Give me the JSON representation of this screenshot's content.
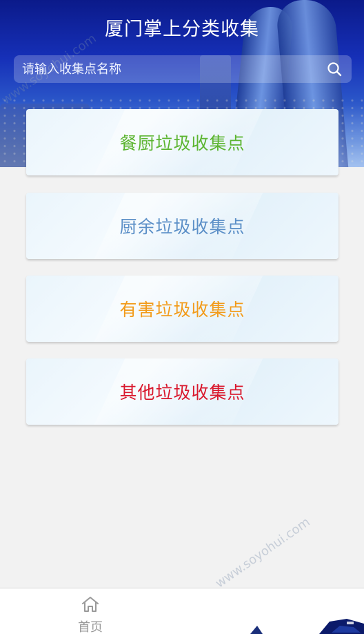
{
  "header": {
    "title": "厦门掌上分类收集"
  },
  "search": {
    "placeholder": "请输入收集点名称",
    "icon": "search-icon"
  },
  "categories": [
    {
      "label": "餐厨垃圾收集点",
      "color": "#5cb531"
    },
    {
      "label": "厨余垃圾收集点",
      "color": "#5b8fc7"
    },
    {
      "label": "有害垃圾收集点",
      "color": "#f29b1a"
    },
    {
      "label": "其他垃圾收集点",
      "color": "#d9182d"
    }
  ],
  "tabbar": {
    "home_label": "首页",
    "home_icon": "home-icon"
  },
  "watermark": {
    "text": "www.soyohui.com"
  }
}
